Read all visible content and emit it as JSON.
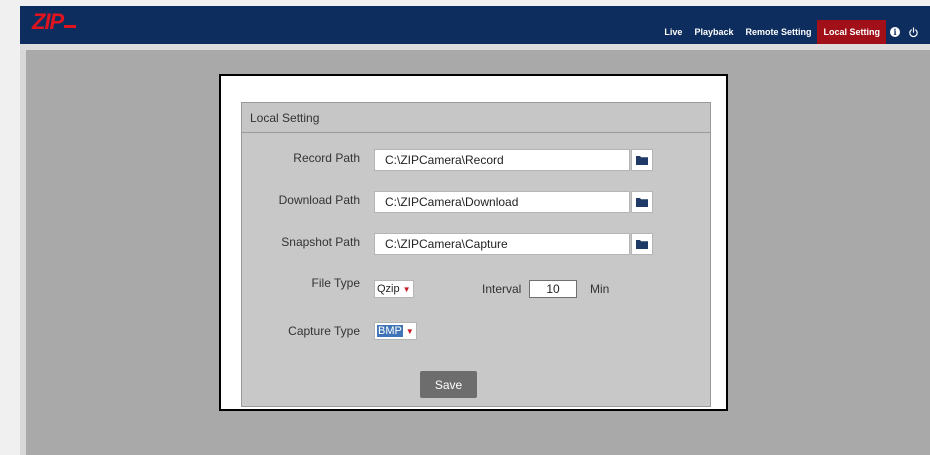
{
  "header": {
    "logo_text": "ZIP",
    "nav": [
      {
        "label": "Live"
      },
      {
        "label": "Playback"
      },
      {
        "label": "Remote Setting"
      },
      {
        "label": "Local Setting"
      }
    ],
    "active_tab": "Local Setting",
    "icons": [
      "info-icon",
      "power-icon"
    ],
    "colors": {
      "bar": "#0d2d5e",
      "active": "#a11018",
      "logo": "#e0141e"
    }
  },
  "panel": {
    "title": "Local Setting",
    "record_path": {
      "label": "Record Path",
      "value": "C:\\ZIPCamera\\Record"
    },
    "download_path": {
      "label": "Download Path",
      "value": "C:\\ZIPCamera\\Download"
    },
    "snapshot_path": {
      "label": "Snapshot Path",
      "value": "C:\\ZIPCamera\\Capture"
    },
    "file_type": {
      "label": "File Type",
      "value": "Qzip"
    },
    "interval": {
      "label": "Interval",
      "value": "10",
      "unit": "Min"
    },
    "capture_type": {
      "label": "Capture Type",
      "value": "BMP"
    },
    "save_label": "Save"
  }
}
